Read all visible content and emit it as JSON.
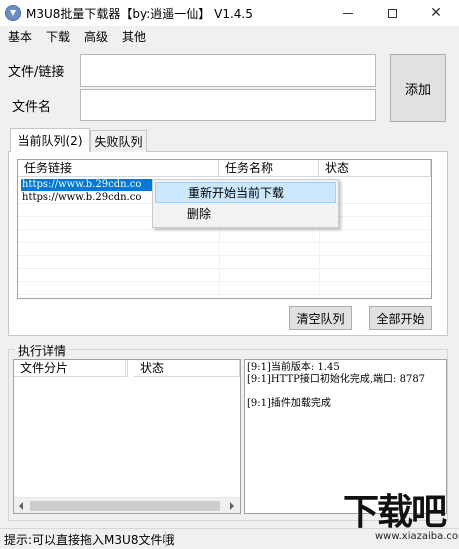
{
  "window": {
    "title": "M3U8批量下载器【by:逍遥一仙】  V1.4.5",
    "minimize_glyph": "—",
    "maximize_glyph": "□",
    "close_glyph": "✕"
  },
  "menu": [
    "基本",
    "下载",
    "高级",
    "其他"
  ],
  "form": {
    "file_label": "文件/链接",
    "file_value": "",
    "name_label": "文件名",
    "name_value": "",
    "add_button": "添加"
  },
  "tabs": [
    {
      "label": "当前队列(2)",
      "active": true
    },
    {
      "label": "失败队列",
      "active": false
    }
  ],
  "task_table": {
    "columns": [
      "任务链接",
      "任务名称",
      "状态"
    ],
    "rows": [
      {
        "link": "https://www.b.29cdn.co",
        "name": "",
        "status": "",
        "selected": true
      },
      {
        "link": "https://www.b.29cdn.co",
        "name": "",
        "status": "",
        "selected": false
      }
    ]
  },
  "context_menu": {
    "items": [
      "重新开始当前下载",
      "删除"
    ],
    "highlight_color": "#cce8ff"
  },
  "buttons": {
    "clear_queue": "清空队列",
    "start_all": "全部开始"
  },
  "details": {
    "group_title": "执行详情",
    "parts_columns": [
      "文件分片",
      "状态"
    ],
    "log_lines": [
      "[9:1]当前版本: 1.45",
      "[9:1]HTTP接口初始化完成,端口: 8787",
      "[9:1]插件加载完成"
    ]
  },
  "status_bar": {
    "text": "提示:可以直接拖入M3U8文件哦"
  },
  "watermark": {
    "logo": "下载吧",
    "url": "www.xiazaiba.com"
  },
  "colors": {
    "selection": "#0078d7",
    "window_bg": "#f0f0f0"
  }
}
